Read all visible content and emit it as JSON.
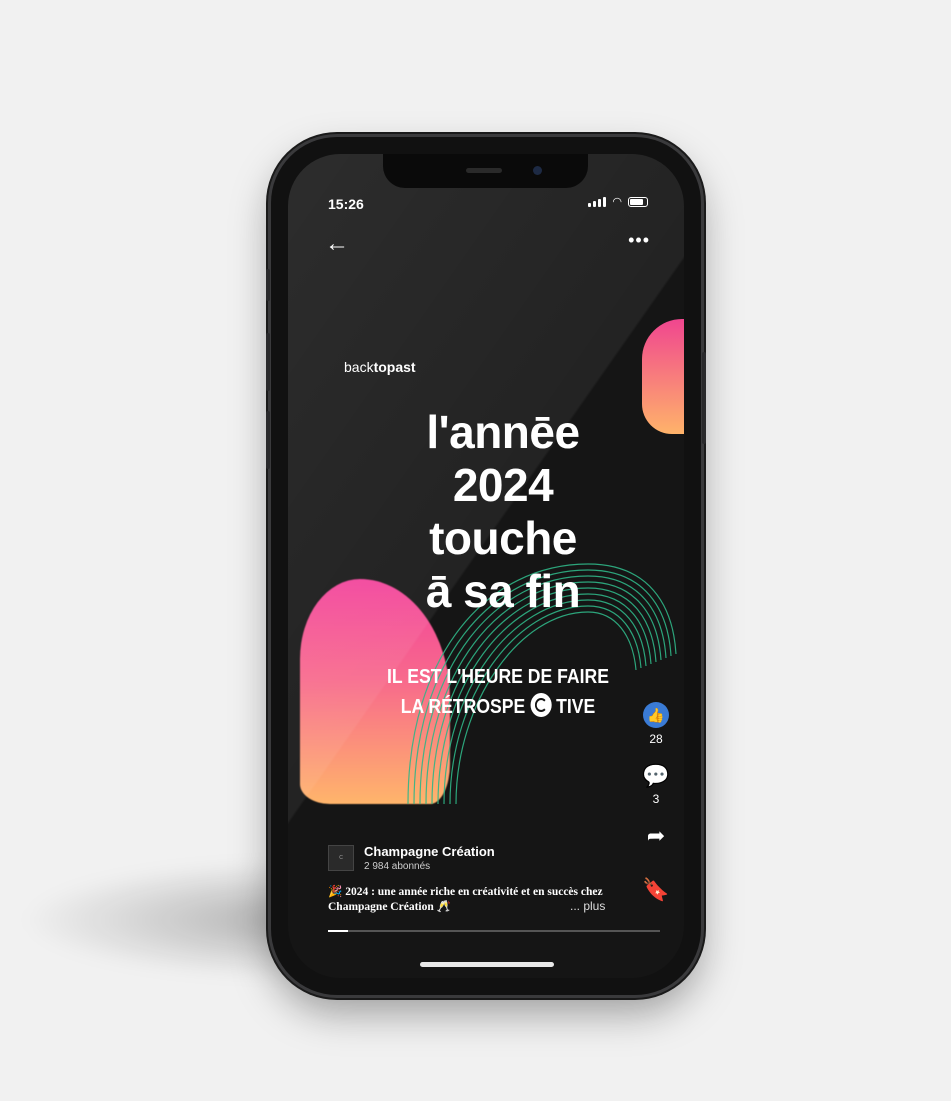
{
  "status_bar": {
    "time": "15:26"
  },
  "nav": {
    "back_icon": "arrow-left-icon",
    "more_icon": "more-dots-icon"
  },
  "post": {
    "brand_prefix": "back",
    "brand_bold": "topast",
    "headline": [
      "l'annēe",
      "2024",
      "touche",
      "ā sa fin"
    ],
    "sub_line1": "IL EST L'HEURE DE FAIRE",
    "sub_line2_a": "LA RÉTROSPE",
    "sub_line2_b": "TIVE"
  },
  "actions": {
    "likes": "28",
    "comments": "3",
    "icons": [
      "thumbs-up-icon",
      "comment-icon",
      "share-icon",
      "bookmark-icon"
    ]
  },
  "author": {
    "name": "Champagne Création",
    "followers": "2 984 abonnés"
  },
  "caption": {
    "text": "🎉 2024 : une année riche en créativité et en succès chez Champagne Création 🥂",
    "more": "... plus"
  },
  "progress": 0.06,
  "colors": {
    "accent": "#3a7bd5",
    "pink": "#f2429b",
    "orange": "#ffb56b",
    "green": "#2fb587"
  }
}
